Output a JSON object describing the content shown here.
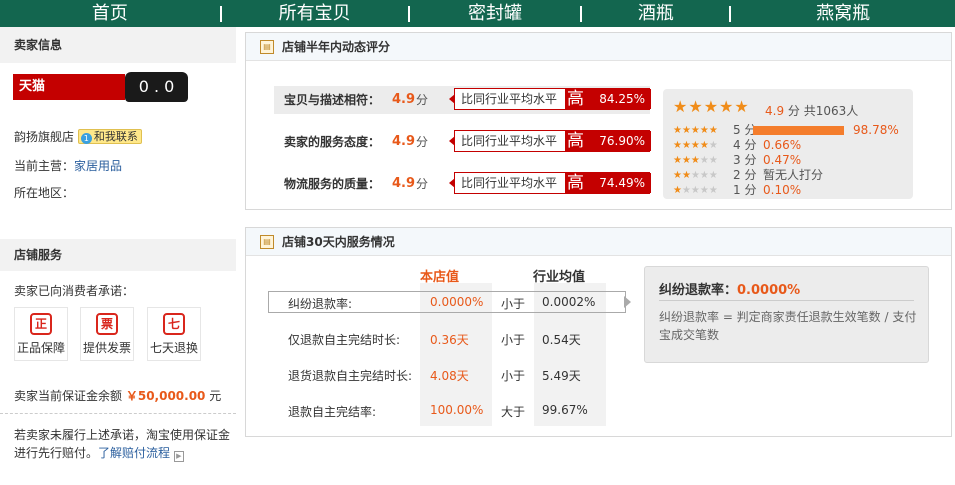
{
  "nav": {
    "items": [
      "首页",
      "所有宝贝",
      "密封罐",
      "酒瓶",
      "燕窝瓶"
    ]
  },
  "seller": {
    "section_title": "卖家信息",
    "tmall_text": "天猫 TMALL.COM",
    "tmall_cat": "0 . 0",
    "shop_name": "韵扬旗舰店",
    "contact_label": "和我联系",
    "main_business_label": "当前主营：",
    "main_business_value": "家居用品",
    "region_label": "所在地区："
  },
  "service": {
    "section_title": "店铺服务",
    "promise_label": "卖家已向消费者承诺：",
    "badges": [
      {
        "icon": "正",
        "label": "正品保障"
      },
      {
        "icon": "票",
        "label": "提供发票"
      },
      {
        "icon": "七",
        "label": "七天退换"
      }
    ],
    "deposit_label": "卖家当前保证金余额",
    "deposit_amount": "￥50,000.00",
    "deposit_unit": "元",
    "note": "若卖家未履行上述承诺，淘宝使用保证金进行先行赔付。",
    "note_link": "了解赔付流程"
  },
  "rating_panel": {
    "title": "店铺半年内动态评分",
    "rows": [
      {
        "label": "宝贝与描述相符：",
        "score": "4.9",
        "unit": "分",
        "compare": "比同行业平均水平",
        "level": "高",
        "percent": "84.25%"
      },
      {
        "label": "卖家的服务态度：",
        "score": "4.9",
        "unit": "分",
        "compare": "比同行业平均水平",
        "level": "高",
        "percent": "76.90%"
      },
      {
        "label": "物流服务的质量：",
        "score": "4.9",
        "unit": "分",
        "compare": "比同行业平均水平",
        "level": "高",
        "percent": "74.49%"
      }
    ],
    "distribution": {
      "stars": "★★★★★",
      "score": "4.9",
      "unit_total": "分 共1063人",
      "rows": [
        {
          "stars_on": "★★★★★",
          "stars_off": "",
          "label": "5 分",
          "percent": "98.78%",
          "fraction": 0.9878
        },
        {
          "stars_on": "★★★★",
          "stars_off": "★",
          "label": "4 分",
          "percent": "0.66%",
          "fraction": 0.0066
        },
        {
          "stars_on": "★★★",
          "stars_off": "★★",
          "label": "3 分",
          "percent": "0.47%",
          "fraction": 0.0047
        },
        {
          "stars_on": "★★",
          "stars_off": "★★★",
          "label": "2 分",
          "percent": "暂无人打分",
          "fraction": 0
        },
        {
          "stars_on": "★",
          "stars_off": "★★★★",
          "label": "1 分",
          "percent": "0.10%",
          "fraction": 0.001
        }
      ]
    }
  },
  "service_panel": {
    "title": "店铺30天内服务情况",
    "col_store": "本店值",
    "col_industry": "行业均值",
    "rows": [
      {
        "label": "纠纷退款率:",
        "store": "0.0000%",
        "cmp": "小于",
        "industry": "0.0002%"
      },
      {
        "label": "仅退款自主完结时长:",
        "store": "0.36天",
        "cmp": "小于",
        "industry": "0.54天"
      },
      {
        "label": "退货退款自主完结时长:",
        "store": "4.08天",
        "cmp": "小于",
        "industry": "5.49天"
      },
      {
        "label": "退款自主完结率:",
        "store": "100.00%",
        "cmp": "大于",
        "industry": "99.67%"
      }
    ],
    "explain_title": "纠纷退款率：",
    "explain_value": "0.0000%",
    "explain_desc": "纠纷退款率 = 判定商家责任退款生效笔数 / 支付宝成交笔数"
  },
  "colors": {
    "nav_bg": "#13664f",
    "accent_red": "#c40000",
    "accent_orange": "#e8591a",
    "star": "#f08c19"
  }
}
